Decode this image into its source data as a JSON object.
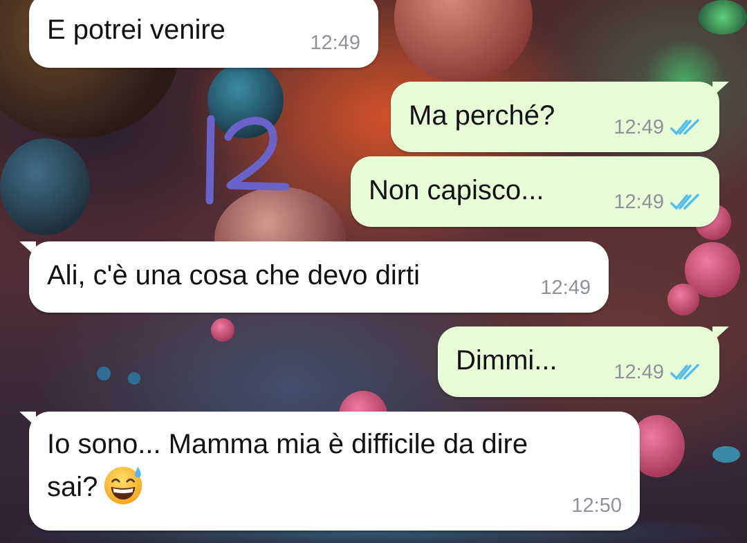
{
  "annotation_mark": "12",
  "messages": [
    {
      "direction": "incoming",
      "text": "E potrei venire",
      "time": "12:49"
    },
    {
      "direction": "outgoing",
      "text": "Ma perché?",
      "time": "12:49",
      "status": "read"
    },
    {
      "direction": "outgoing",
      "text": "Non capisco...",
      "time": "12:49",
      "status": "read"
    },
    {
      "direction": "incoming",
      "text": "Ali, c'è una cosa che devo dirti",
      "time": "12:49"
    },
    {
      "direction": "outgoing",
      "text": "Dimmi...",
      "time": "12:49",
      "status": "read"
    },
    {
      "direction": "incoming",
      "text": "Io sono... Mamma mia è difficile da dire\nsai?",
      "time": "12:50",
      "emoji": "grinning-face-with-sweat"
    }
  ],
  "colors": {
    "incoming_bubble": "#ffffff",
    "outgoing_bubble": "#e7fdd8",
    "read_ticks": "#53bdeb",
    "timestamp": "#8d9298",
    "annotation_ink": "#6a63c9"
  },
  "icons": {
    "read_status": "double-check-icon",
    "emoji": "grinning-face-with-sweat-icon"
  }
}
